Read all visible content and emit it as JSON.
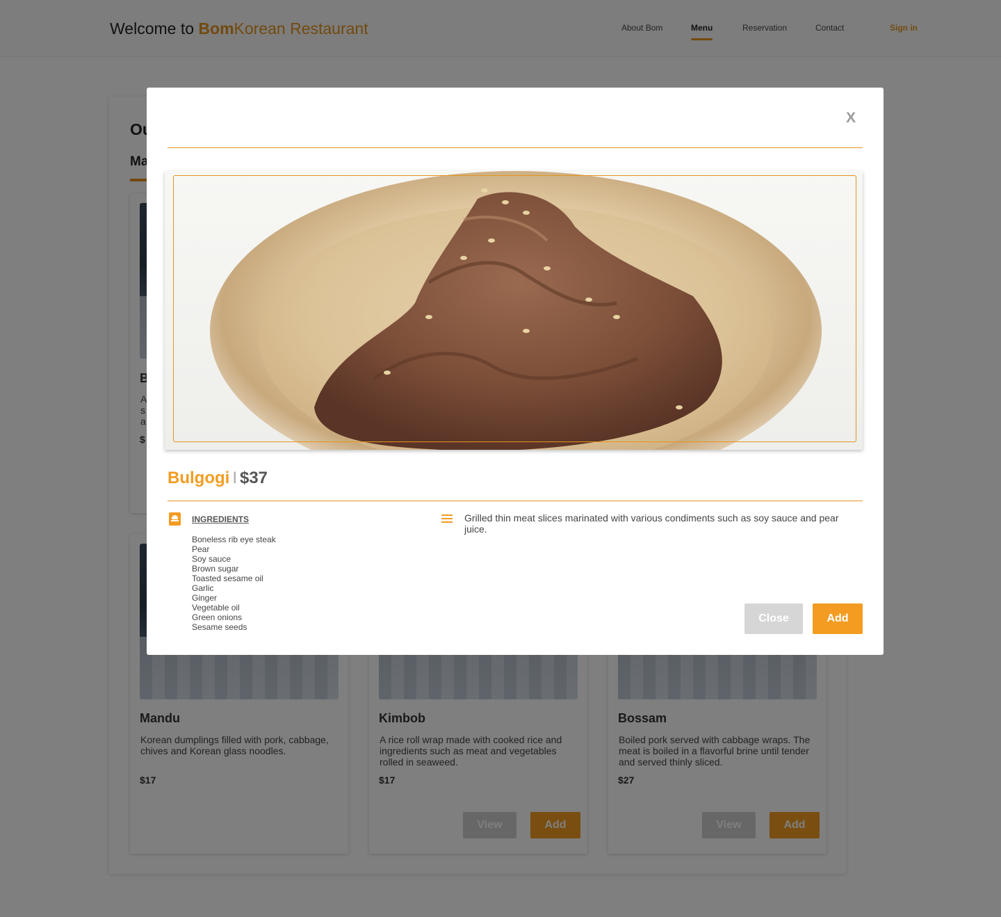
{
  "header": {
    "brand_prefix": "Welcome to ",
    "brand_bom": "Bom",
    "brand_rest": "Korean Restaurant",
    "nav": [
      "About Bom",
      "Menu",
      "Reservation",
      "Contact"
    ],
    "signin": "Sign in"
  },
  "background": {
    "section_title_visible": "Ou",
    "tab_visible": "Ma",
    "top_card_fragments": {
      "name": "B",
      "desc_lines": [
        "A",
        "s",
        "a"
      ],
      "price": "$"
    },
    "cards": [
      {
        "name": "Mandu",
        "desc": "Korean dumplings filled with pork, cabbage, chives and Korean glass noodles.",
        "price": "$17"
      },
      {
        "name": "Kimbob",
        "desc": "A rice roll wrap made with cooked rice and ingredients such as meat and vegetables rolled in seaweed.",
        "price": "$17",
        "view_label": "View",
        "add_label": "Add"
      },
      {
        "name": "Bossam",
        "desc": "Boiled pork served with cabbage wraps. The meat is boiled in a flavorful brine until tender and served thinly sliced.",
        "price": "$27",
        "view_label": "View",
        "add_label": "Add"
      }
    ]
  },
  "modal": {
    "close_x": "X",
    "dish_name": "Bulgogi",
    "separator": "I",
    "price": "$37",
    "ingredients_heading": "INGREDIENTS",
    "ingredients": [
      "Boneless rib eye steak",
      "Pear",
      "Soy sauce",
      "Brown sugar",
      "Toasted sesame oil",
      "Garlic",
      "Ginger",
      "Vegetable oil",
      "Green onions",
      "Sesame seeds"
    ],
    "description": "Grilled thin meat slices marinated with various condiments such as soy sauce and pear juice.",
    "close_label": "Close",
    "add_label": "Add"
  },
  "colors": {
    "accent": "#f39c21",
    "brand": "#e5941e",
    "button_gray": "#d6d6d6"
  },
  "icons": {
    "ingredients": "chef-hat-icon",
    "description": "list-lines-icon"
  }
}
